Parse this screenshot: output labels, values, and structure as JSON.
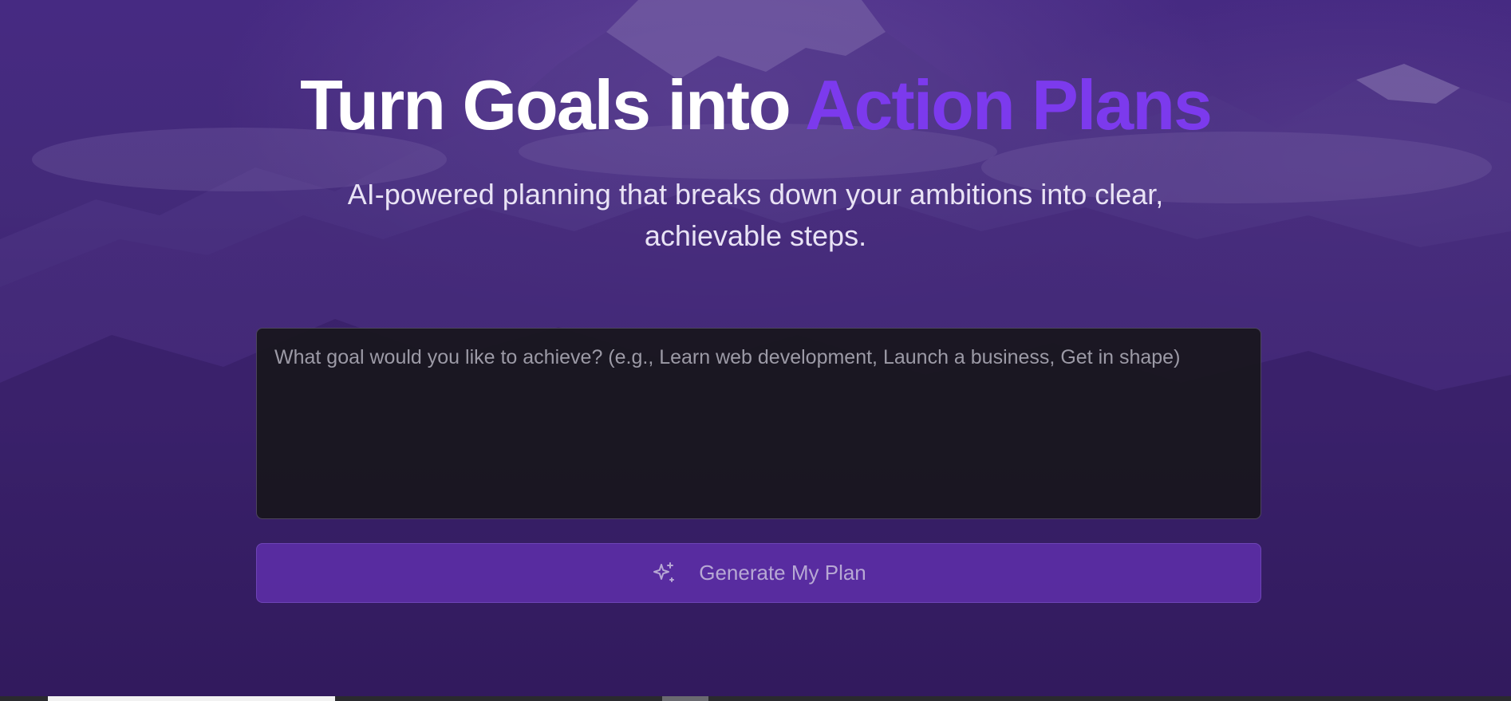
{
  "hero": {
    "title_main": "Turn Goals into ",
    "title_accent": "Action Plans",
    "subtitle": "AI-powered planning that breaks down your ambitions into clear, achievable steps."
  },
  "goal_input": {
    "value": "",
    "placeholder": "What goal would you like to achieve? (e.g., Learn web development, Launch a business, Get in shape)"
  },
  "generate_button": {
    "label": "Generate My Plan",
    "icon": "sparkles-icon"
  },
  "colors": {
    "accent": "#7c3aed",
    "title": "#ffffff",
    "input_bg": "#18161e",
    "button_bg": "#6432b4"
  }
}
